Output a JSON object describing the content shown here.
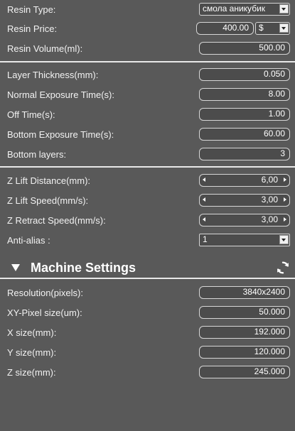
{
  "resin": {
    "type_label": "Resin Type:",
    "type_value": "смола аникубик",
    "price_label": "Resin Price:",
    "price_value": "400.00",
    "currency": "$",
    "volume_label": "Resin Volume(ml):",
    "volume_value": "500.00"
  },
  "exposure": {
    "layer_thickness_label": "Layer Thickness(mm):",
    "layer_thickness_value": "0.050",
    "normal_exposure_label": "Normal Exposure Time(s):",
    "normal_exposure_value": "8.00",
    "off_time_label": "Off Time(s):",
    "off_time_value": "1.00",
    "bottom_exposure_label": "Bottom Exposure Time(s):",
    "bottom_exposure_value": "60.00",
    "bottom_layers_label": "Bottom layers:",
    "bottom_layers_value": "3"
  },
  "motion": {
    "z_lift_distance_label": "Z Lift Distance(mm):",
    "z_lift_distance_value": "6,00",
    "z_lift_speed_label": "Z Lift Speed(mm/s):",
    "z_lift_speed_value": "3,00",
    "z_retract_speed_label": "Z Retract Speed(mm/s):",
    "z_retract_speed_value": "3,00",
    "anti_alias_label": "Anti-alias :",
    "anti_alias_value": "1"
  },
  "machine": {
    "title": "Machine Settings",
    "resolution_label": "Resolution(pixels):",
    "resolution_value": "3840x2400",
    "xy_pixel_label": "XY-Pixel size(um):",
    "xy_pixel_value": "50.000",
    "x_size_label": "X size(mm):",
    "x_size_value": "192.000",
    "y_size_label": "Y size(mm):",
    "y_size_value": "120.000",
    "z_size_label": "Z size(mm):",
    "z_size_value": "245.000"
  },
  "icons": {
    "refresh": "refresh-icon",
    "collapse": "triangle-down-icon"
  },
  "colors": {
    "background": "#595959",
    "field_border": "#d6d6d6",
    "text": "#ffffff"
  }
}
